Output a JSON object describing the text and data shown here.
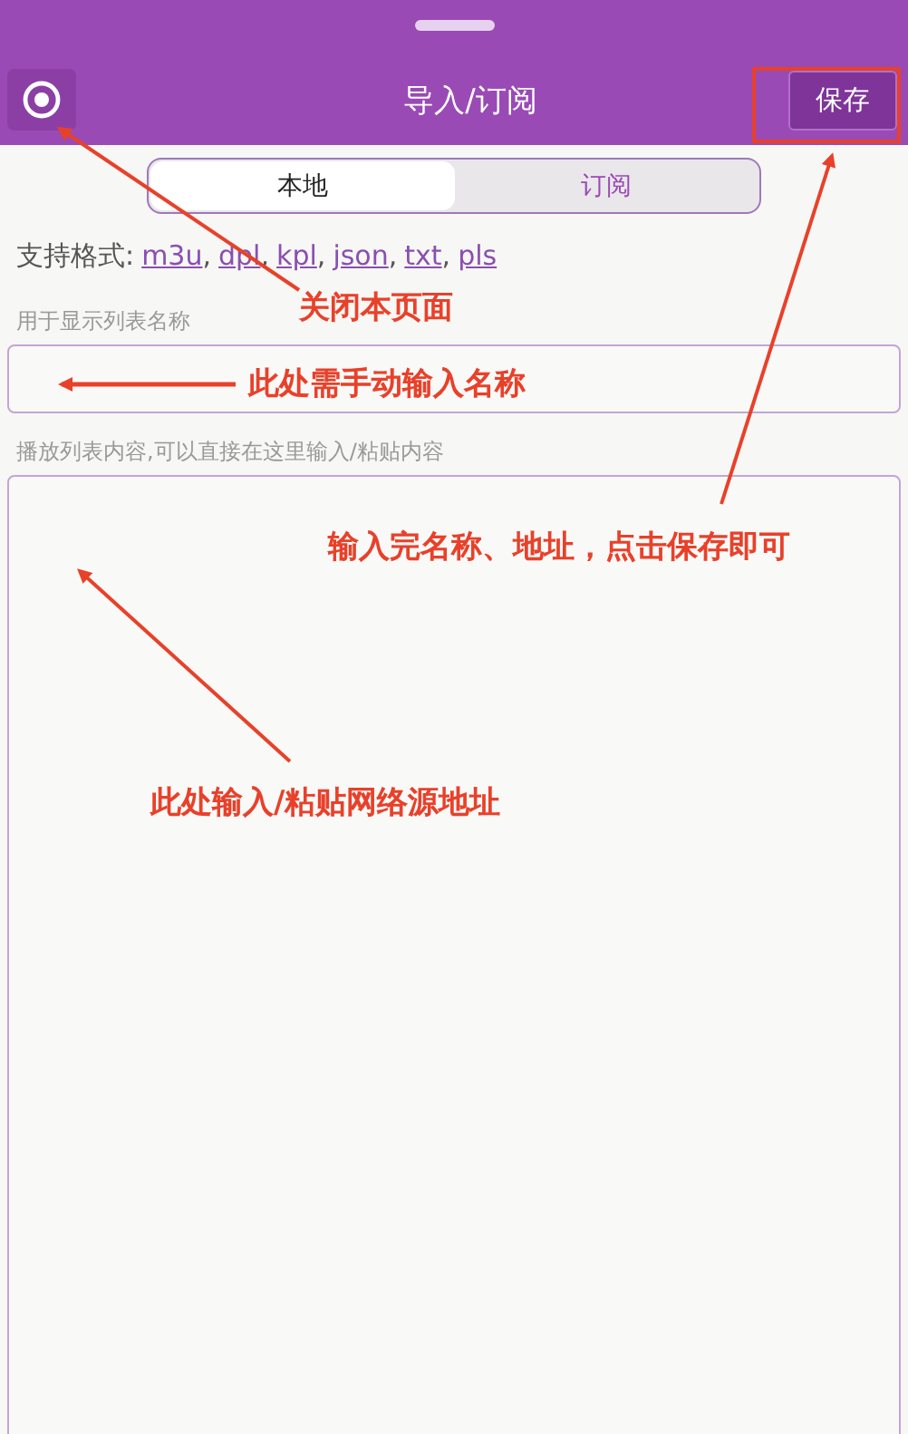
{
  "header": {
    "title": "导入/订阅",
    "save_button": "保存"
  },
  "tabs": [
    {
      "label": "本地",
      "selected": true
    },
    {
      "label": "订阅",
      "selected": false
    }
  ],
  "formats": {
    "label": "支持格式:",
    "separator": ",",
    "links": [
      "m3u",
      "dpl",
      "kpl",
      "json",
      "txt",
      "pls"
    ]
  },
  "name_field": {
    "label": "用于显示列表名称"
  },
  "content_field": {
    "label": "播放列表内容,可以直接在这里输入/粘贴内容"
  },
  "annotations": [
    "关闭本页面",
    "此处需手动输入名称",
    "输入完名称、地址，点击保存即可",
    "此处输入/粘贴网络源地址"
  ]
}
